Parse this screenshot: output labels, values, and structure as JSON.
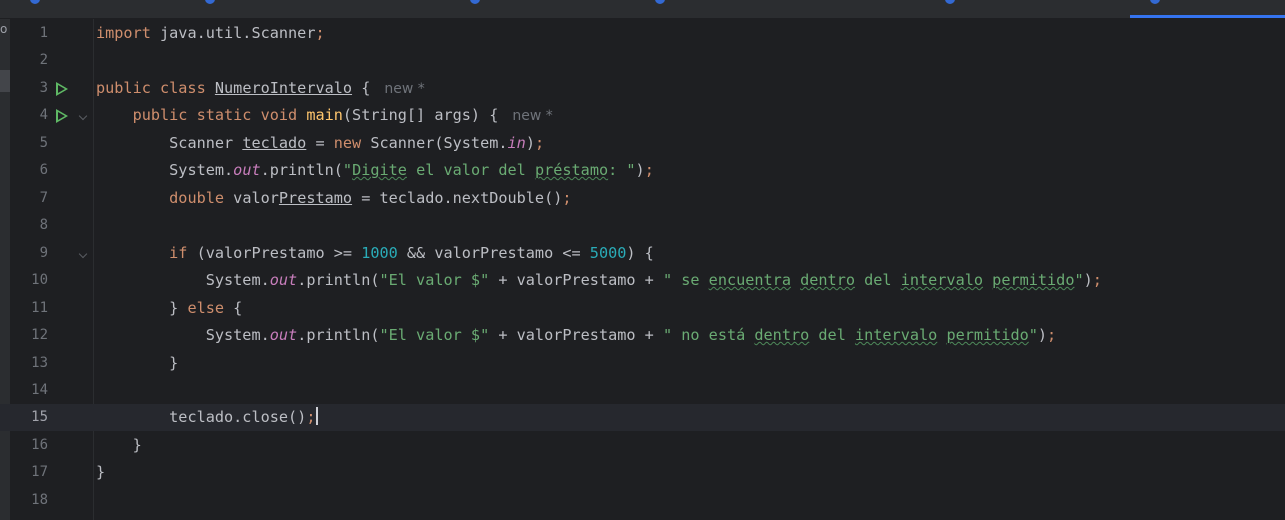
{
  "colors": {
    "background": "#1e1f22",
    "keyword": "#cf8e6d",
    "string": "#6aab73",
    "number": "#2aacb8",
    "static_field": "#c77dbb",
    "text": "#bcbec4",
    "run_icon": "#5fb865",
    "accent": "#3574f0"
  },
  "side_strip": {
    "label": "o"
  },
  "icons": {
    "run": "run-icon",
    "fold": "chevron-down-icon"
  },
  "editor": {
    "line_numbers": [
      "1",
      "2",
      "3",
      "4",
      "5",
      "6",
      "7",
      "8",
      "9",
      "10",
      "11",
      "12",
      "13",
      "14",
      "15",
      "16",
      "17",
      "18"
    ],
    "current_line": 15,
    "l1": {
      "kw": "import",
      "rest": " java.util.Scanner",
      "semi": ";"
    },
    "l3": {
      "kw": "public class",
      "name": "NumeroIntervalo",
      "brace": " {",
      "hint": "new *"
    },
    "l4": {
      "kw": "public static void",
      "name": "main",
      "args": "(String[] args) {",
      "hint": "new *"
    },
    "l5": {
      "type": "Scanner ",
      "var": "teclado",
      "eq": " = ",
      "new": "new",
      "ctor": " Scanner(System.",
      "field": "in",
      "close": ")",
      "semi": ";"
    },
    "l6": {
      "pre": "System.",
      "field": "out",
      "call": ".println(",
      "str": "\"",
      "s1": "Digite",
      "s2": " el valor del ",
      "s3": "préstamo",
      "s4": ": \"",
      "close": ")",
      "semi": ";"
    },
    "l7": {
      "kw": "double",
      "var1": " valor",
      "var2": "Prestamo",
      "rest": " = teclado.nextDouble()",
      "semi": ";"
    },
    "l9": {
      "kw": "if",
      "a": " (valorPrestamo >= ",
      "n1": "1000",
      "b": " && valorPrestamo <= ",
      "n2": "5000",
      "c": ") {"
    },
    "l10": {
      "pre": "System.",
      "field": "out",
      "call": ".println(",
      "s0": "\"El valor $\"",
      "mid": " + valorPrestamo + ",
      "q": "\" se ",
      "w1": "encuentra",
      "sp1": " ",
      "w2": "dentro",
      "sp2": " del ",
      "w3": "intervalo",
      "sp3": " ",
      "w4": "permitido",
      "end": "\"",
      "close": ")",
      "semi": ";"
    },
    "l11": {
      "brace": "} ",
      "kw": "else",
      "rest": " {"
    },
    "l12": {
      "pre": "System.",
      "field": "out",
      "call": ".println(",
      "s0": "\"El valor $\"",
      "mid": " + valorPrestamo + ",
      "q": "\" no está ",
      "w1": "dentro",
      "sp1": " del ",
      "w2": "intervalo",
      "sp2": " ",
      "w3": "permitido",
      "end": "\"",
      "close": ")",
      "semi": ";"
    },
    "l13": {
      "text": "}"
    },
    "l15": {
      "text": "teclado.close()",
      "semi": ";"
    },
    "l16": {
      "text": "}"
    },
    "l17": {
      "text": "}"
    }
  }
}
